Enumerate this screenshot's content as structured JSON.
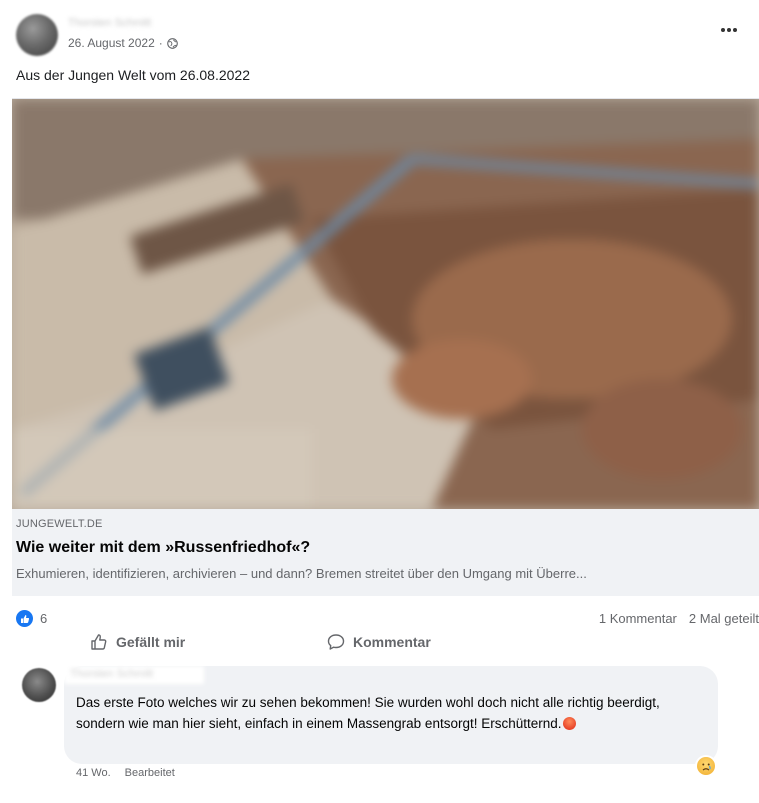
{
  "post": {
    "author": "Thorsten Schmitt",
    "date": "26. August 2022",
    "separator": "·",
    "privacy_icon": "globe-icon",
    "text": "Aus der Jungen Welt vom 26.08.2022"
  },
  "link_preview": {
    "domain": "JUNGEWELT.DE",
    "title": "Wie weiter mit dem »Russenfriedhof«?",
    "description": "Exhumieren, identifizieren, archivieren – und dann? Bremen streitet über den Umgang mit Überre..."
  },
  "reactions": {
    "icon": "like-icon",
    "count": "6",
    "comments": "1 Kommentar",
    "shares": "2 Mal geteilt"
  },
  "actions": {
    "like_label": "Gefällt mir",
    "comment_label": "Kommentar"
  },
  "comment": {
    "author": "Thorsten Schmitt",
    "text": "Das erste Foto welches wir zu sehen bekommen! Sie wurden wohl doch nicht alle richtig beerdigt, sondern wie man hier sieht, einfach in einem Massengrab entsorgt! Erschütternd.",
    "emoji_icon": "angry-emoji-icon",
    "time": "41 Wo.",
    "edited": "Bearbeitet",
    "reaction_icon": "sad-reaction-icon"
  },
  "colors": {
    "brand_blue": "#1877f2",
    "secondary_text": "#65676b",
    "card_background": "#f0f2f5"
  }
}
